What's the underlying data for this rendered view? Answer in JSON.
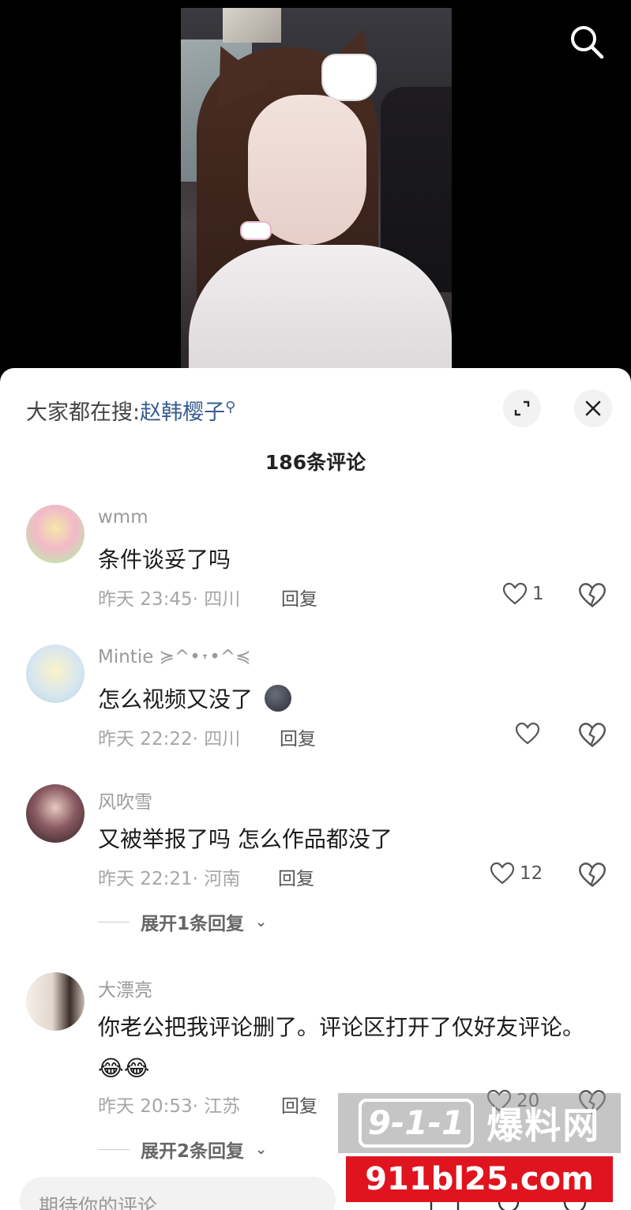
{
  "video": {
    "search_icon": "search-icon"
  },
  "sheet": {
    "hot_search_prefix": "大家都在搜:",
    "hot_search_keyword": "赵韩樱子",
    "comment_count_label": "186条评论",
    "expand_icon": "expand-icon",
    "close_icon": "close-icon"
  },
  "comments": [
    {
      "username": "wmm",
      "content": "条件谈妥了吗",
      "meta": "昨天 23:45· 四川",
      "reply_label": "回复",
      "likes": "1"
    },
    {
      "username": "Mintie ≽^•˕•^≼",
      "content": "怎么视频又没了",
      "meta": "昨天 22:22· 四川",
      "reply_label": "回复",
      "likes": ""
    },
    {
      "username": "风吹雪",
      "content": "又被举报了吗 怎么作品都没了",
      "meta": "昨天 22:21· 河南",
      "reply_label": "回复",
      "likes": "12",
      "expand_label": "展开1条回复"
    },
    {
      "username": "大漂亮",
      "content": "你老公把我评论删了。评论区打开了仅好友评论。😂😂",
      "meta": "昨天 20:53· 江苏",
      "reply_label": "回复",
      "likes": "20",
      "expand_label": "展开2条回复"
    }
  ],
  "composer": {
    "placeholder": "期待你的评论"
  },
  "watermark": {
    "logo_text": "9-1-1",
    "site_name": "爆料网",
    "url": "911bl25.com"
  }
}
